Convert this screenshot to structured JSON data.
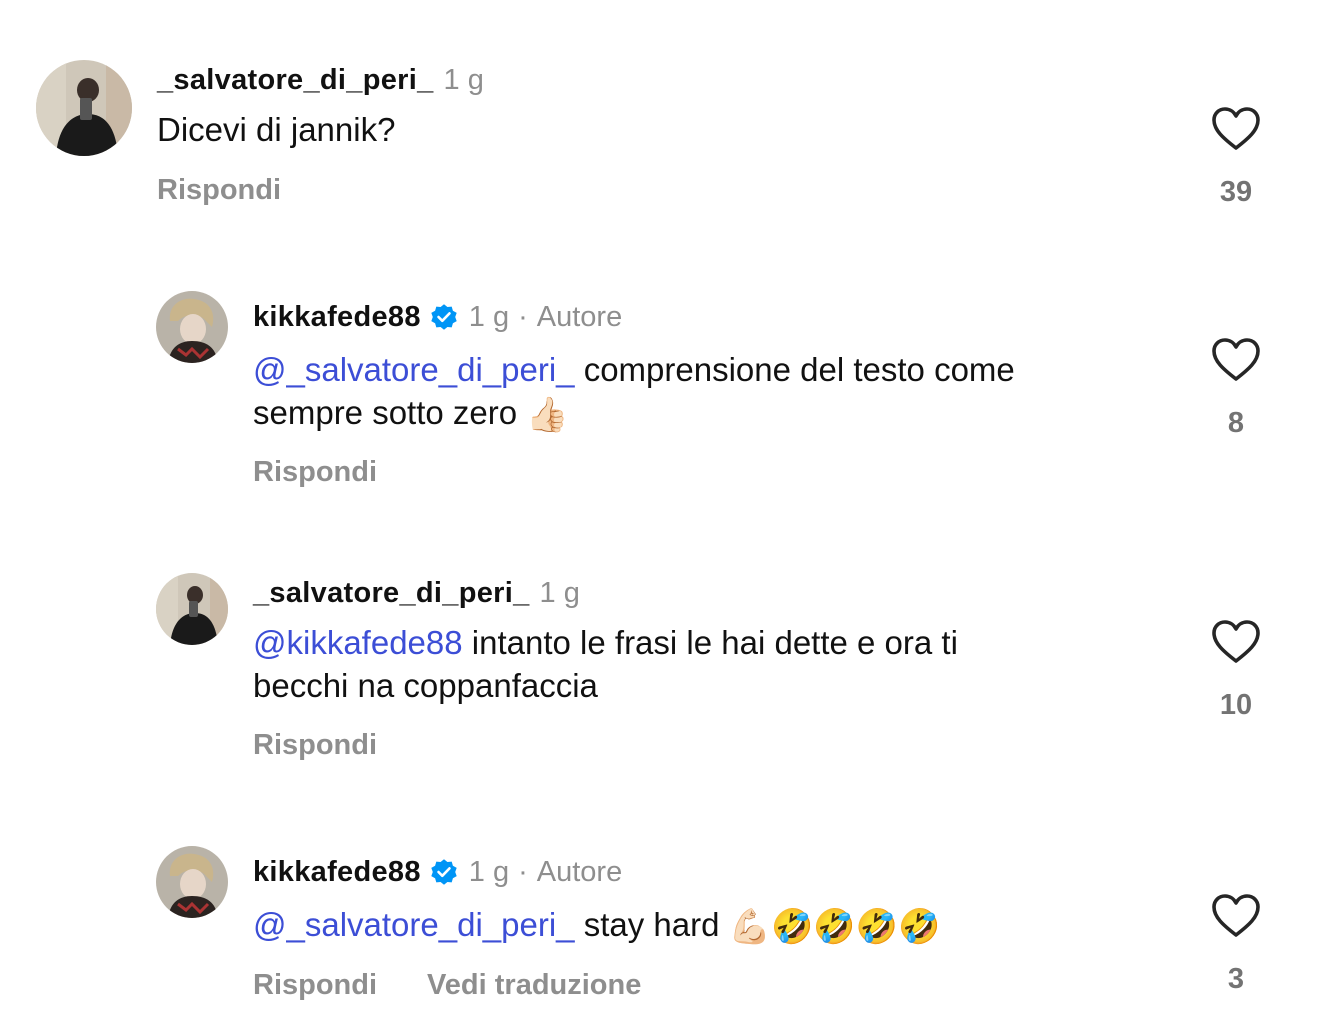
{
  "comments": [
    {
      "username": "_salvatore_di_peri_",
      "time": "1 g",
      "verified": false,
      "author_label": "",
      "mention": "",
      "text": "Dicevi di jannik?",
      "text_line2": "",
      "emoji": "",
      "reply_label": "Rispondi",
      "likes": "39"
    },
    {
      "username": "kikkafede88",
      "time": "1 g",
      "verified": true,
      "author_label": "Autore",
      "mention": "@_salvatore_di_peri_",
      "text": " comprensione del testo come",
      "text_line2": "sempre sotto zero ",
      "emoji": "👍🏻",
      "reply_label": "Rispondi",
      "likes": "8"
    },
    {
      "username": "_salvatore_di_peri_",
      "time": "1 g",
      "verified": false,
      "author_label": "",
      "mention": "@kikkafede88",
      "text": " intanto le frasi le hai dette e ora ti",
      "text_line2": "becchi na coppanfaccia",
      "emoji": "",
      "reply_label": "Rispondi",
      "likes": "10"
    },
    {
      "username": "kikkafede88",
      "time": "1 g",
      "verified": true,
      "author_label": "Autore",
      "mention": "@_salvatore_di_peri_",
      "text": " stay hard ",
      "text_line2": "",
      "emoji": "💪🏻🤣🤣🤣🤣",
      "reply_label": "Rispondi",
      "translate_label": "Vedi traduzione",
      "likes": "3"
    }
  ],
  "icons": {
    "like": "heart-outline-icon",
    "verified": "verified-badge-icon"
  },
  "colors": {
    "mention": "#3c4ed6",
    "muted": "#8e8e8e",
    "verified": "#0095f6",
    "heart": "#262626"
  }
}
